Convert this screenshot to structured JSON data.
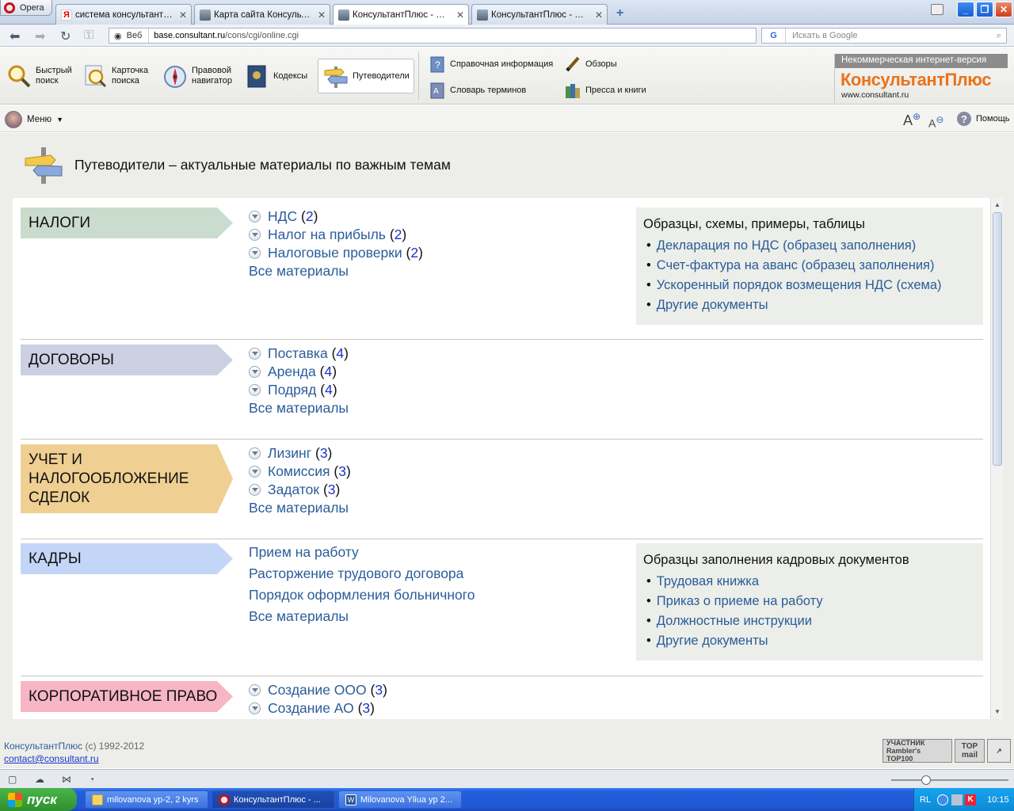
{
  "browser": {
    "menu_label": "Opera",
    "tabs": [
      {
        "title": "система консультант п...",
        "icon": "yandex-icon"
      },
      {
        "title": "Карта сайта Консульта...",
        "icon": "consultant-icon"
      },
      {
        "title": "КонсультантПлюс - Пу...",
        "icon": "consultant-icon",
        "active": true
      },
      {
        "title": "КонсультантПлюс - Пр...",
        "icon": "consultant-icon"
      }
    ],
    "new_tab": "+",
    "address_mode": "Веб",
    "url_domain": "base.consultant.ru",
    "url_path": "/cons/cgi/online.cgi",
    "search_placeholder": "Искать в Google",
    "search_engine": "G"
  },
  "toolbar": {
    "items": [
      {
        "label1": "Быстрый",
        "label2": "поиск",
        "icon": "magnifier-icon"
      },
      {
        "label1": "Карточка",
        "label2": "поиска",
        "icon": "search-card-icon"
      },
      {
        "label1": "Правовой",
        "label2": "навигатор",
        "icon": "compass-icon"
      },
      {
        "label1": "Кодексы",
        "label2": "",
        "icon": "codex-book-icon"
      },
      {
        "label1": "Путеводители",
        "label2": "",
        "icon": "signpost-icon",
        "selected": true
      }
    ],
    "small": [
      {
        "label": "Справочная информация",
        "icon": "reference-book-icon"
      },
      {
        "label": "Обзоры",
        "icon": "pen-icon"
      },
      {
        "label": "Словарь терминов",
        "icon": "dictionary-icon"
      },
      {
        "label": "Пресса и книги",
        "icon": "books-icon"
      }
    ],
    "brand_top": "Некоммерческая интернет-версия",
    "brand_logo": "КонсультантПлюс",
    "brand_site": "www.consultant.ru"
  },
  "menubar": {
    "menu_label": "Меню",
    "font_increase": "A",
    "font_decrease": "A",
    "help_label": "Помощь"
  },
  "page": {
    "title": "Путеводители – актуальные материалы по важным темам",
    "sections": [
      {
        "name": "НАЛОГИ",
        "color": "#c9dccd",
        "topics": [
          {
            "label": "НДС",
            "count": "2"
          },
          {
            "label": "Налог на прибыль",
            "count": "2"
          },
          {
            "label": "Налоговые проверки",
            "count": "2"
          }
        ],
        "all": "Все материалы",
        "side": {
          "title": "Образцы, схемы, примеры, таблицы",
          "items": [
            "Декларация по НДС (образец заполнения)",
            "Счет-фактура на аванс (образец заполнения)",
            "Ускоренный порядок возмещения НДС (схема)",
            "Другие документы"
          ]
        }
      },
      {
        "name": "ДОГОВОРЫ",
        "color": "#cdcfe2",
        "topics": [
          {
            "label": "Поставка",
            "count": "4"
          },
          {
            "label": "Аренда",
            "count": "4"
          },
          {
            "label": "Подряд",
            "count": "4"
          }
        ],
        "all": "Все материалы"
      },
      {
        "name": "УЧЕТ И НАЛОГООБЛОЖЕНИЕ СДЕЛОК",
        "name_lines": [
          "УЧЕТ И",
          "НАЛОГООБЛОЖЕНИЕ",
          "СДЕЛОК"
        ],
        "color": "#efcf92",
        "topics": [
          {
            "label": "Лизинг",
            "count": "3"
          },
          {
            "label": "Комиссия",
            "count": "3"
          },
          {
            "label": "Задаток",
            "count": "3"
          }
        ],
        "all": "Все материалы"
      },
      {
        "name": "КАДРЫ",
        "color": "#c3d6f8",
        "links": [
          "Прием на работу",
          "Расторжение трудового договора",
          "Порядок оформления больничного"
        ],
        "all": "Все материалы",
        "side": {
          "title": "Образцы заполнения кадровых документов",
          "items": [
            "Трудовая книжка",
            "Приказ о приеме на работу",
            "Должностные инструкции",
            "Другие документы"
          ]
        }
      },
      {
        "name": "КОРПОРАТИВНОЕ ПРАВО",
        "color": "#f7b5c6",
        "topics": [
          {
            "label": "Создание ООО",
            "count": "3"
          },
          {
            "label": "Создание АО",
            "count": "3"
          }
        ]
      }
    ]
  },
  "footer": {
    "copyright_brand": "КонсультантПлюс",
    "copyright_years": " (c) 1992-2012",
    "contact": "contact@consultant.ru",
    "badge1": "УЧАСТНИК Rambler's TOP100",
    "badge2": "TOP mail"
  },
  "taskbar": {
    "start": "пуск",
    "tasks": [
      {
        "title": "milovanova yp-2, 2 kyrs",
        "icon": "folder-icon"
      },
      {
        "title": "КонсультантПлюс - ...",
        "icon": "opera-icon",
        "active": true
      },
      {
        "title": "Milovanova Yliua yp 2...",
        "icon": "word-icon"
      }
    ],
    "lang": "RL",
    "clock": "10:15"
  }
}
